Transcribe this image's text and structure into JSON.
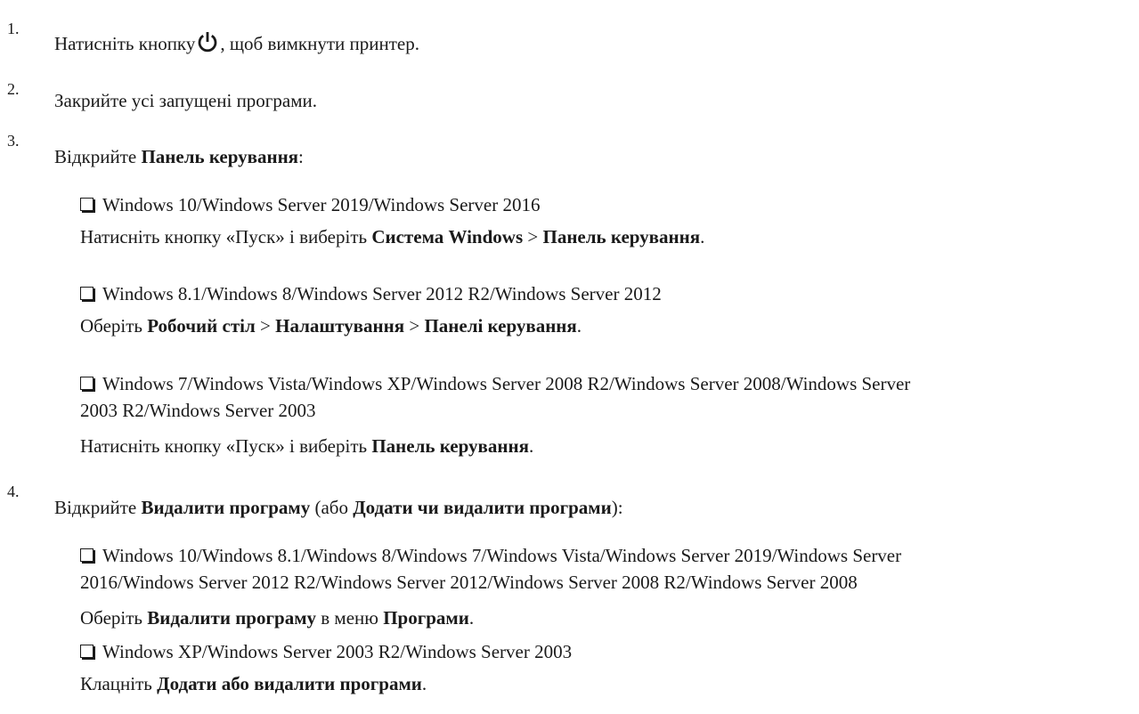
{
  "steps": [
    {
      "number": "1.",
      "before_icon": "Натисніть кнопку",
      "icon": "power-icon",
      "after_icon": ", щоб вимкнути принтер."
    },
    {
      "number": "2.",
      "text": "Закрийте усі запущені програми."
    },
    {
      "number": "3.",
      "text_plain": "Відкрийте ",
      "text_bold": "Панель керування",
      "text_end": ":",
      "items": [
        {
          "label": "Windows 10/Windows Server 2019/Windows Server 2016",
          "instr_plain1": "Натисніть кнопку «Пуск» і виберіть ",
          "instr_bold1": "Система Windows",
          "instr_plain2": " > ",
          "instr_bold2": "Панель керування",
          "instr_end": "."
        },
        {
          "label": "Windows 8.1/Windows 8/Windows Server 2012 R2/Windows Server 2012",
          "instr_plain1": "Оберіть ",
          "instr_bold1": "Робочий стіл",
          "instr_plain2": " > ",
          "instr_bold2": "Налаштування",
          "instr_plain3": " > ",
          "instr_bold3": "Панелі керування",
          "instr_end": "."
        },
        {
          "label_line1": "Windows 7/Windows Vista/Windows XP/Windows Server 2008 R2/Windows Server 2008/Windows Server",
          "label_line2": "2003 R2/Windows Server 2003",
          "instr_plain1": "Натисніть кнопку «Пуск» і виберіть ",
          "instr_bold1": "Панель керування",
          "instr_end": "."
        }
      ]
    },
    {
      "number": "4.",
      "text_plain": "Відкрийте ",
      "text_bold": "Видалити програму",
      "text_plain2": " (або ",
      "text_bold2": "Додати чи видалити програми",
      "text_end": "):",
      "items": [
        {
          "label_line1": "Windows 10/Windows 8.1/Windows 8/Windows 7/Windows Vista/Windows Server 2019/Windows Server",
          "label_line2": "2016/Windows Server 2012 R2/Windows Server 2012/Windows Server 2008 R2/Windows Server 2008",
          "instr_plain1": "Оберіть ",
          "instr_bold1": "Видалити програму",
          "instr_plain2": " в меню ",
          "instr_bold2": "Програми",
          "instr_end": "."
        },
        {
          "label": "Windows XP/Windows Server 2003 R2/Windows Server 2003",
          "instr_plain1": "Клацніть ",
          "instr_bold1": "Додати або видалити програми",
          "instr_end": "."
        }
      ]
    }
  ]
}
